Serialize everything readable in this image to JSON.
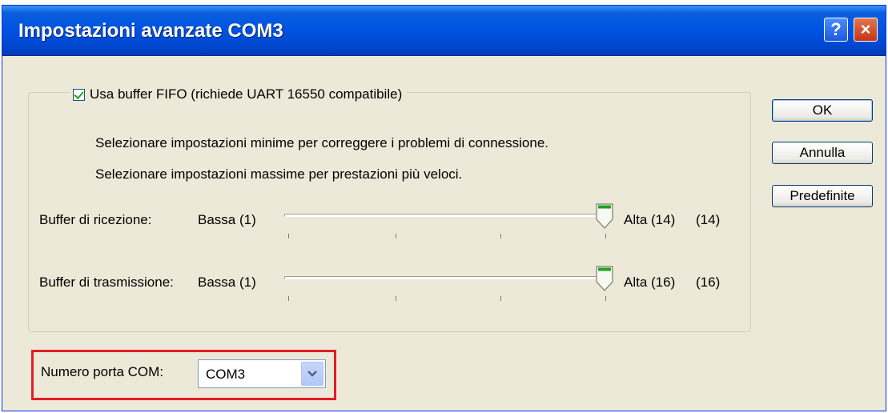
{
  "window": {
    "title": "Impostazioni avanzate COM3",
    "help_label": "?",
    "close_label": "×"
  },
  "fifo": {
    "checkbox_label": "Usa buffer FIFO (richiede UART 16550 compatibile)",
    "checked": true,
    "hint_min": "Selezionare impostazioni minime per correggere i problemi di connessione.",
    "hint_max": "Selezionare impostazioni massime per prestazioni più veloci."
  },
  "receive": {
    "label": "Buffer di ricezione:",
    "low_label": "Bassa (1)",
    "high_label": "Alta (14)",
    "value_label": "(14)",
    "value": 14,
    "min": 1,
    "max": 14
  },
  "transmit": {
    "label": "Buffer di trasmissione:",
    "low_label": "Bassa (1)",
    "high_label": "Alta (16)",
    "value_label": "(16)",
    "value": 16,
    "min": 1,
    "max": 16
  },
  "com_port": {
    "label": "Numero porta COM:",
    "selected": "COM3"
  },
  "buttons": {
    "ok": "OK",
    "cancel": "Annulla",
    "defaults": "Predefinite"
  },
  "colors": {
    "title_bar": "#0054e3",
    "highlight": "#e31e25",
    "slider_thumb_accent": "#21a121"
  },
  "icons": {
    "help": "question-mark",
    "close": "x",
    "dropdown": "chevron-down",
    "slider_thumb": "pointed-thumb",
    "check": "checkmark"
  }
}
